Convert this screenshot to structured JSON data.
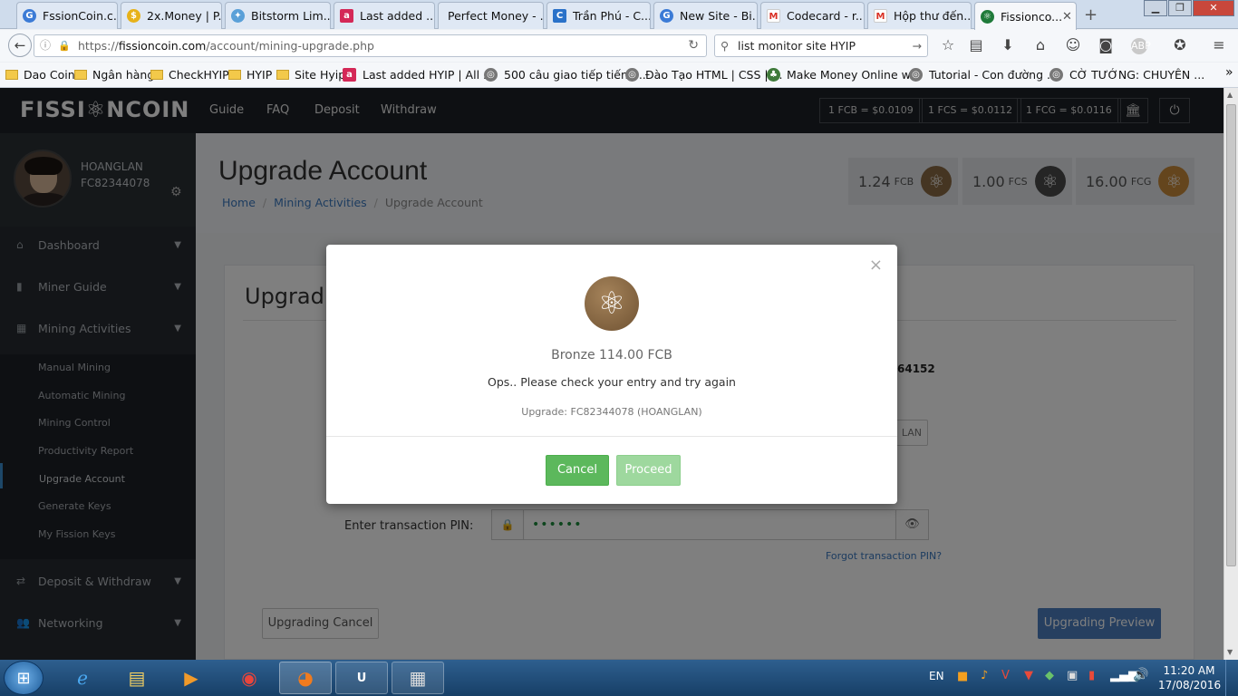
{
  "browser": {
    "tabs": [
      {
        "label": "FssionCoin.c...",
        "icon": "globe-icon"
      },
      {
        "label": "2x.Money | P...",
        "icon": "coin-icon"
      },
      {
        "label": "Bitstorm Lim...",
        "icon": "bitstorm-icon"
      },
      {
        "label": "Last added ...",
        "icon": "a-icon"
      },
      {
        "label": "Perfect Money - ...",
        "icon": "none"
      },
      {
        "label": "Trần Phú - C...",
        "icon": "c-icon"
      },
      {
        "label": "New Site - Bi...",
        "icon": "globe-icon"
      },
      {
        "label": "Codecard - r...",
        "icon": "gmail-icon"
      },
      {
        "label": "Hộp thư đến...",
        "icon": "gmail-icon"
      },
      {
        "label": "Fissionco...",
        "icon": "fission-icon",
        "active": true
      }
    ],
    "url_prefix": "https://",
    "url_domain": "fissioncoin.com",
    "url_path": "/account/mining-upgrade.php",
    "search_value": "list monitor site HYIP",
    "bookmarks": [
      "Dao Coin",
      "Ngân hàng",
      "CheckHYIP",
      "HYIP",
      "Site Hyip",
      "Last added HYIP | All ...",
      "500 câu giao tiếp tiếng...",
      "Đào Tạo HTML | CSS | ...",
      "Make Money Online w...",
      "Tutorial - Con đường ...",
      "CỜ TƯỚNG: CHUYÊN ..."
    ]
  },
  "site": {
    "logo": "FISSI⚛NCOIN",
    "menu": [
      "Guide",
      "FAQ",
      "Deposit",
      "Withdraw"
    ],
    "rates": [
      "1 FCB = $0.0109",
      "1 FCS = $0.0112",
      "1 FCG = $0.0116"
    ],
    "user": {
      "name": "HOANGLAN",
      "id": "FC82344078"
    },
    "sidebar": {
      "items": [
        "Dashboard",
        "Miner Guide",
        "Mining Activities",
        "Deposit & Withdraw",
        "Networking"
      ],
      "sub_items": [
        "Manual Mining",
        "Automatic Mining",
        "Mining Control",
        "Productivity Report",
        "Upgrade Account",
        "Generate Keys",
        "My Fission Keys"
      ]
    },
    "page_title": "Upgrade Account",
    "breadcrumb": [
      "Home",
      "Mining Activities",
      "Upgrade Account"
    ],
    "balances": [
      {
        "amount": "1.24",
        "unit": "FCB",
        "color": "#8a6a45"
      },
      {
        "amount": "1.00",
        "unit": "FCS",
        "color": "#4a4a4a"
      },
      {
        "amount": "16.00",
        "unit": "FCG",
        "color": "#c98a3a"
      }
    ],
    "card_title": "Upgradi",
    "partial_value": "64152",
    "partial_button": "LAN",
    "pin_label": "Enter transaction PIN:",
    "pin_value": "••••••",
    "forgot_pin": "Forgot transaction PIN?",
    "cancel_upgrade": "Upgrading Cancel",
    "preview_upgrade": "Upgrading Preview"
  },
  "modal": {
    "package": "Bronze 114.00 FCB",
    "message": "Ops.. Please check your entry and try again",
    "detail": "Upgrade: FC82344078 (HOANGLAN)",
    "cancel": "Cancel",
    "proceed": "Proceed",
    "close": "×"
  },
  "taskbar": {
    "lang": "EN",
    "time": "11:20 AM",
    "date": "17/08/2016"
  }
}
